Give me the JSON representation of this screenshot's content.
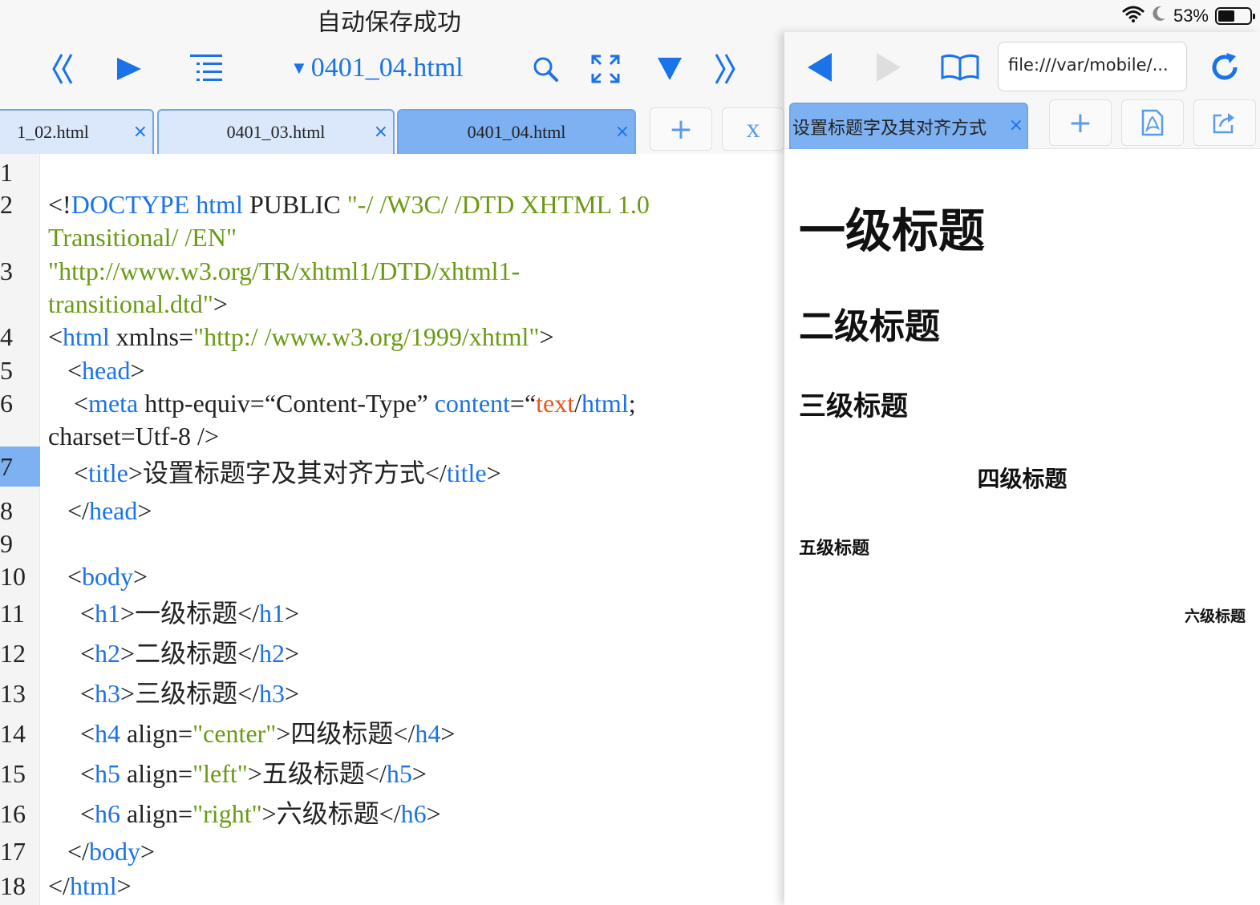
{
  "status_bar": {
    "message": "自动保存成功",
    "battery": "53%",
    "battery_level_percent": 53
  },
  "editor": {
    "toolbar": {
      "prev_icon": "double-left-chevron",
      "run_icon": "play-triangle",
      "outline_icon": "list-outline",
      "file_name": "0401_04.html",
      "search_icon": "magnifier",
      "fullscreen_icon": "expand-arrows",
      "menu_icon": "down-triangle",
      "next_icon": "double-right-chevron"
    },
    "tabs": [
      {
        "label": "1_02.html",
        "active": false
      },
      {
        "label": "0401_03.html",
        "active": false
      },
      {
        "label": "0401_04.html",
        "active": true
      }
    ],
    "tab_close": "×",
    "add_tab": "+",
    "close_all": "x",
    "active_line": "7",
    "line_numbers": [
      "1",
      "2",
      "3",
      "4",
      "5",
      "6",
      "7",
      "8",
      "9",
      "10",
      "11",
      "12",
      "13",
      "14",
      "15",
      "16",
      "17",
      "18"
    ],
    "code": [
      [],
      [
        [
          "<!",
          ""
        ],
        [
          "DOCTYPE html",
          "tag"
        ],
        [
          " PUBLIC ",
          ""
        ],
        [
          "\"-/ /W3C/ /DTD XHTML 1.0",
          "str"
        ]
      ],
      [
        [
          "Transitional/ /EN\"",
          "str"
        ]
      ],
      [
        [
          "\"http://www.w3.org/TR/xhtml1/DTD/xhtml1-",
          "str"
        ]
      ],
      [
        [
          "transitional.dtd\"",
          "str"
        ],
        [
          ">",
          ""
        ]
      ],
      [
        [
          "<",
          ""
        ],
        [
          "html",
          "tag"
        ],
        [
          " xmlns=",
          ""
        ],
        [
          "\"http:/ /www.w3.org/1999/xhtml\"",
          "str"
        ],
        [
          ">",
          ""
        ]
      ],
      [
        [
          "   <",
          ""
        ],
        [
          "head",
          "tag"
        ],
        [
          ">",
          ""
        ]
      ],
      [
        [
          "    <",
          ""
        ],
        [
          "meta",
          "tag"
        ],
        [
          " http-equiv=“Content-Type” ",
          ""
        ],
        [
          "content",
          "tag"
        ],
        [
          "=“",
          ""
        ],
        [
          "text",
          "kw"
        ],
        [
          "/",
          ""
        ],
        [
          "html",
          "tag"
        ],
        [
          ";",
          ""
        ]
      ],
      [
        [
          "charset=Utf-8 />",
          ""
        ]
      ],
      [
        [
          "    <",
          ""
        ],
        [
          "title",
          "tag"
        ],
        [
          ">设置标题字及其对齐方式</",
          ""
        ],
        [
          "title",
          "tag"
        ],
        [
          ">",
          ""
        ]
      ],
      [
        [
          "   </",
          ""
        ],
        [
          "head",
          "tag"
        ],
        [
          ">",
          ""
        ]
      ],
      [],
      [
        [
          "   <",
          ""
        ],
        [
          "body",
          "tag"
        ],
        [
          ">",
          ""
        ]
      ],
      [
        [
          "     <",
          ""
        ],
        [
          "h1",
          "tag"
        ],
        [
          ">一级标题</",
          ""
        ],
        [
          "h1",
          "tag"
        ],
        [
          ">",
          ""
        ]
      ],
      [
        [
          "     <",
          ""
        ],
        [
          "h2",
          "tag"
        ],
        [
          ">二级标题</",
          ""
        ],
        [
          "h2",
          "tag"
        ],
        [
          ">",
          ""
        ]
      ],
      [
        [
          "     <",
          ""
        ],
        [
          "h3",
          "tag"
        ],
        [
          ">三级标题</",
          ""
        ],
        [
          "h3",
          "tag"
        ],
        [
          ">",
          ""
        ]
      ],
      [
        [
          "     <",
          ""
        ],
        [
          "h4",
          "tag"
        ],
        [
          " align=",
          ""
        ],
        [
          "\"center\"",
          "str"
        ],
        [
          ">四级标题</",
          ""
        ],
        [
          "h4",
          "tag"
        ],
        [
          ">",
          ""
        ]
      ],
      [
        [
          "     <",
          ""
        ],
        [
          "h5",
          "tag"
        ],
        [
          " align=",
          ""
        ],
        [
          "\"left\"",
          "str"
        ],
        [
          ">五级标题</",
          ""
        ],
        [
          "h5",
          "tag"
        ],
        [
          ">",
          ""
        ]
      ],
      [
        [
          "     <",
          ""
        ],
        [
          "h6",
          "tag"
        ],
        [
          " align=",
          ""
        ],
        [
          "\"right\"",
          "str"
        ],
        [
          ">六级标题</",
          ""
        ],
        [
          "h6",
          "tag"
        ],
        [
          ">",
          ""
        ]
      ],
      [
        [
          "   </",
          ""
        ],
        [
          "body",
          "tag"
        ],
        [
          ">",
          ""
        ]
      ],
      [
        [
          "</",
          ""
        ],
        [
          "html",
          "tag"
        ],
        [
          ">",
          ""
        ]
      ]
    ]
  },
  "preview": {
    "toolbar": {
      "back_icon": "left-triangle",
      "forward_icon": "right-triangle",
      "bookmarks_icon": "open-book",
      "url": "file:///var/mobile/...",
      "reload_icon": "circular-arrow"
    },
    "tab_label": "设置标题字及其对齐方式",
    "tab_close": "×",
    "add_tab": "+",
    "pdf_icon": "pdf-document",
    "share_icon": "share-arrow",
    "headings": {
      "h1": "一级标题",
      "h2": "二级标题",
      "h3": "三级标题",
      "h4": "四级标题",
      "h5": "五级标题",
      "h6": "六级标题"
    }
  },
  "colors": {
    "accent": "#1a73e8",
    "string": "#6a9a12",
    "keyword": "#e8541a",
    "active_tab": "#7db1f2"
  }
}
